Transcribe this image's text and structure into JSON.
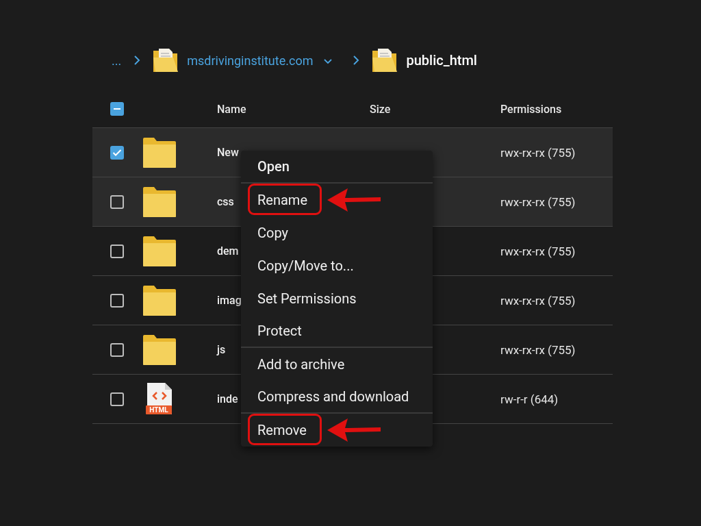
{
  "breadcrumb": {
    "ellipsis": "...",
    "items": [
      {
        "label": "msdrivinginstitute.com",
        "current": false,
        "dropdown": true
      },
      {
        "label": "public_html",
        "current": true,
        "dropdown": false
      }
    ]
  },
  "table": {
    "select_all": {
      "indeterminate": true
    },
    "columns": [
      "Name",
      "Size",
      "Permissions"
    ],
    "rows": [
      {
        "kind": "folder",
        "name": "New",
        "permissions": "rwx-rx-rx (755)",
        "checked": true,
        "highlighted": true
      },
      {
        "kind": "folder",
        "name": "css",
        "permissions": "rwx-rx-rx (755)",
        "checked": false,
        "highlighted": true
      },
      {
        "kind": "folder",
        "name": "dem",
        "permissions": "rwx-rx-rx (755)",
        "checked": false,
        "highlighted": false
      },
      {
        "kind": "folder",
        "name": "imag",
        "permissions": "rwx-rx-rx (755)",
        "checked": false,
        "highlighted": false
      },
      {
        "kind": "folder",
        "name": "js",
        "permissions": "rwx-rx-rx (755)",
        "checked": false,
        "highlighted": false
      },
      {
        "kind": "html",
        "badge": "HTML",
        "name": "inde",
        "permissions": "rw-r-r (644)",
        "checked": false,
        "highlighted": false
      }
    ]
  },
  "context_menu": {
    "items": [
      {
        "label": "Open",
        "bold": true,
        "divider_after": true,
        "annotated": false
      },
      {
        "label": "Rename",
        "bold": false,
        "divider_after": false,
        "annotated": true
      },
      {
        "label": "Copy",
        "bold": false,
        "divider_after": false,
        "annotated": false
      },
      {
        "label": "Copy/Move to...",
        "bold": false,
        "divider_after": false,
        "annotated": false
      },
      {
        "label": "Set Permissions",
        "bold": false,
        "divider_after": false,
        "annotated": false
      },
      {
        "label": "Protect",
        "bold": false,
        "divider_after": true,
        "annotated": false
      },
      {
        "label": "Add to archive",
        "bold": false,
        "divider_after": false,
        "annotated": false
      },
      {
        "label": "Compress and download",
        "bold": false,
        "divider_after": true,
        "annotated": false
      },
      {
        "label": "Remove",
        "bold": false,
        "divider_after": false,
        "annotated": true
      }
    ]
  }
}
